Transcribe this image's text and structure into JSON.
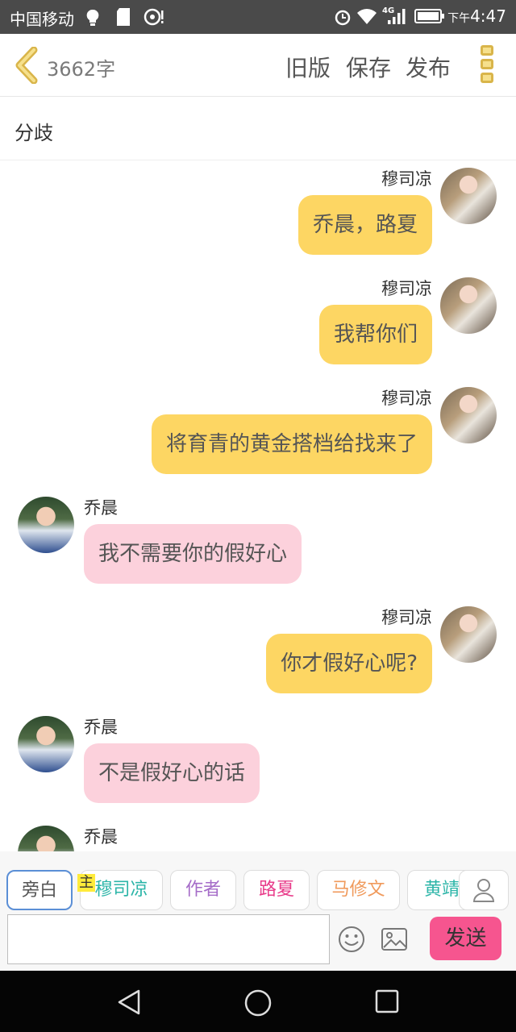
{
  "status_bar": {
    "carrier": "中国移动",
    "network": "4G",
    "time_prefix": "下午",
    "time": "4:47",
    "icons": [
      "bulb-icon",
      "sd-card-icon",
      "hotspot-icon",
      "alarm-icon",
      "wifi-icon",
      "signal-icon",
      "battery-icon"
    ]
  },
  "header": {
    "word_count": "3662字",
    "old_version": "旧版",
    "save": "保存",
    "publish": "发布",
    "accent_color": "#d9b54a"
  },
  "chapter": {
    "title": "分歧"
  },
  "messages": [
    {
      "side": "right",
      "sender": "穆司凉",
      "text": "乔晨，路夏",
      "avatar": "girl-avatar"
    },
    {
      "side": "right",
      "sender": "穆司凉",
      "text": "我帮你们",
      "avatar": "girl-avatar"
    },
    {
      "side": "right",
      "sender": "穆司凉",
      "text": "将育青的黄金搭档给找来了",
      "avatar": "girl-avatar"
    },
    {
      "side": "left",
      "sender": "乔晨",
      "text": "我不需要你的假好心",
      "avatar": "boy-avatar"
    },
    {
      "side": "right",
      "sender": "穆司凉",
      "text": "你才假好心呢?",
      "avatar": "girl-avatar"
    },
    {
      "side": "left",
      "sender": "乔晨",
      "text": "不是假好心的话",
      "avatar": "boy-avatar"
    },
    {
      "side": "left",
      "sender": "乔晨",
      "text": "",
      "avatar": "boy-avatar"
    }
  ],
  "characters": {
    "narration": "旁白",
    "main_tag": "主",
    "items": [
      "穆司凉",
      "作者",
      "路夏",
      "马修文",
      "黄靖"
    ]
  },
  "input": {
    "value": "",
    "placeholder": "",
    "send": "发送"
  },
  "colors": {
    "right_bubble": "#fdd663",
    "left_bubble": "#fcd1dc",
    "send_button": "#f6558f"
  }
}
